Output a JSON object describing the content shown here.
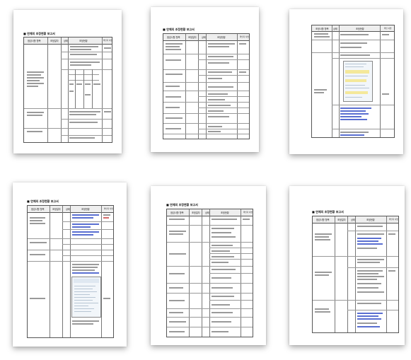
{
  "pages": [
    {
      "id": 1,
      "title": "■ 연체의 조정현황 보고서"
    },
    {
      "id": 2,
      "title": "■ 연체의 조정현황 보고서"
    },
    {
      "id": 3,
      "title": ""
    },
    {
      "id": 4,
      "title": "■ 연체의 조정현황 보고서"
    },
    {
      "id": 5,
      "title": "■ 연체의 조정현황 보고서"
    },
    {
      "id": 6,
      "title": "■ 연체의 조정현황 보고서"
    }
  ],
  "table_header": {
    "col_item": "점검사항 항목",
    "col_date": "조정일자",
    "col_status": "상태",
    "col_detail": "조정현황",
    "col_note": "확인자 서명"
  },
  "page3_header": {
    "col_item": "조정사항 항목",
    "col_status": "상태",
    "col_detail": "조정현황",
    "col_note": "확인 서명"
  }
}
